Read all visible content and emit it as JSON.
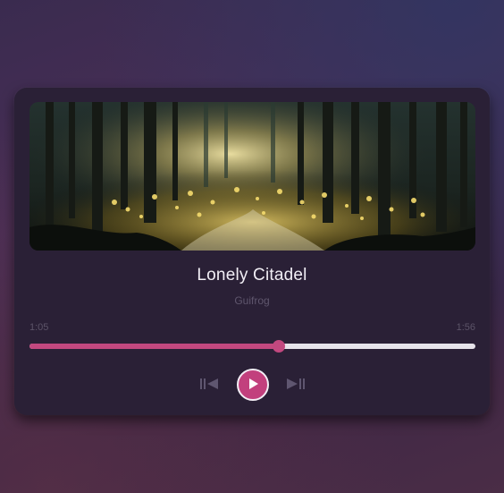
{
  "track": {
    "title": "Lonely Citadel",
    "artist": "Guifrog",
    "current_time": "1:05",
    "duration": "1:56",
    "progress_fraction": 0.56
  },
  "controls": {
    "prev_icon": "skip-previous-icon",
    "play_icon": "play-icon",
    "next_icon": "skip-next-icon"
  },
  "colors": {
    "accent": "#c2487f",
    "card": "#2a2036",
    "track_empty": "#e6e3ea",
    "muted_text": "#5f566d"
  }
}
